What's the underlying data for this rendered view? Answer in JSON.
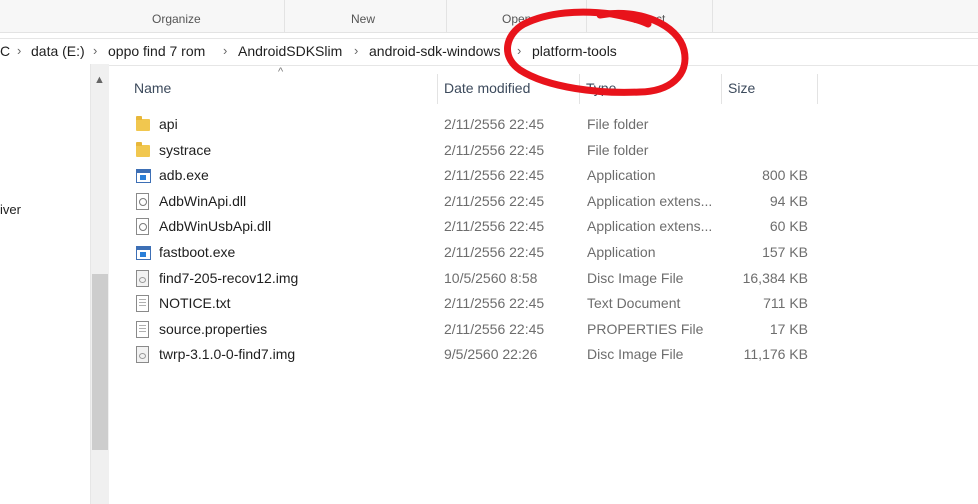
{
  "ribbon": {
    "groups": [
      {
        "label": "Organize"
      },
      {
        "label": "New"
      },
      {
        "label": "Open"
      },
      {
        "label": "Select"
      }
    ]
  },
  "address": {
    "crumbs": [
      "C",
      "data (E:)",
      "oppo find 7 rom",
      "AndroidSDKSlim",
      "android-sdk-windows",
      "platform-tools"
    ]
  },
  "nav": {
    "partial_item": "iver"
  },
  "columns": {
    "name": "Name",
    "date": "Date modified",
    "type": "Type",
    "size": "Size"
  },
  "files": [
    {
      "name": "api",
      "date": "2/11/2556 22:45",
      "type": "File folder",
      "size": "",
      "icon": "folder-icon"
    },
    {
      "name": "systrace",
      "date": "2/11/2556 22:45",
      "type": "File folder",
      "size": "",
      "icon": "folder-icon"
    },
    {
      "name": "adb.exe",
      "date": "2/11/2556 22:45",
      "type": "Application",
      "size": "800 KB",
      "icon": "application-icon"
    },
    {
      "name": "AdbWinApi.dll",
      "date": "2/11/2556 22:45",
      "type": "Application extens...",
      "size": "94 KB",
      "icon": "dll-icon"
    },
    {
      "name": "AdbWinUsbApi.dll",
      "date": "2/11/2556 22:45",
      "type": "Application extens...",
      "size": "60 KB",
      "icon": "dll-icon"
    },
    {
      "name": "fastboot.exe",
      "date": "2/11/2556 22:45",
      "type": "Application",
      "size": "157 KB",
      "icon": "application-icon"
    },
    {
      "name": "find7-205-recov12.img",
      "date": "10/5/2560 8:58",
      "type": "Disc Image File",
      "size": "16,384 KB",
      "icon": "disc-image-icon"
    },
    {
      "name": "NOTICE.txt",
      "date": "2/11/2556 22:45",
      "type": "Text Document",
      "size": "711 KB",
      "icon": "text-document-icon"
    },
    {
      "name": "source.properties",
      "date": "2/11/2556 22:45",
      "type": "PROPERTIES File",
      "size": "17 KB",
      "icon": "generic-file-icon"
    },
    {
      "name": "twrp-3.1.0-0-find7.img",
      "date": "9/5/2560 22:26",
      "type": "Disc Image File",
      "size": "11,176 KB",
      "icon": "disc-image-icon"
    }
  ],
  "colors": {
    "annotation": "#e8131b",
    "folder": "#f1c74f",
    "application": "#3d6fb5"
  }
}
